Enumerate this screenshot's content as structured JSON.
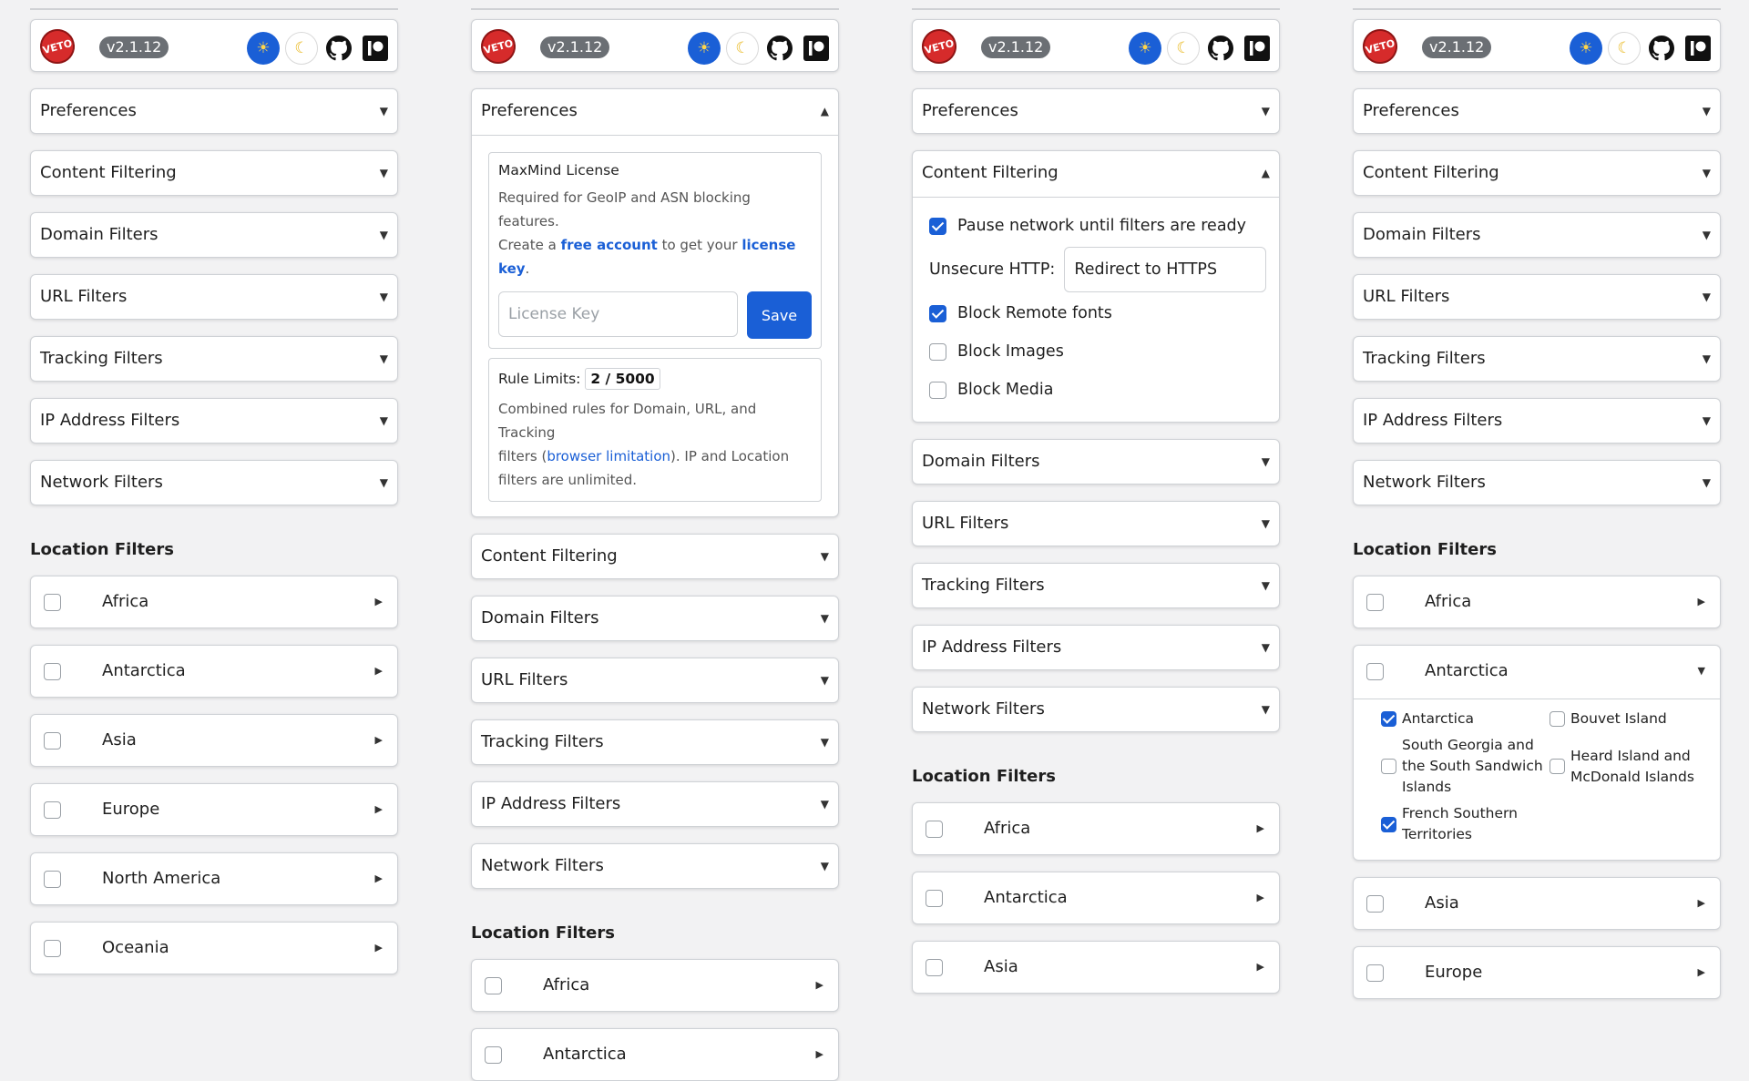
{
  "header": {
    "logo_text": "VETO",
    "version": "v2.1.12",
    "icons": [
      "sun-icon",
      "moon-icon",
      "github-icon",
      "patreon-icon"
    ]
  },
  "accordions": {
    "preferences": "Preferences",
    "content_filtering": "Content Filtering",
    "domain_filters": "Domain Filters",
    "url_filters": "URL Filters",
    "tracking_filters": "Tracking Filters",
    "ip_address_filters": "IP Address Filters",
    "network_filters": "Network Filters"
  },
  "location": {
    "title": "Location Filters",
    "regions": [
      "Africa",
      "Antarctica",
      "Asia",
      "Europe",
      "North America",
      "Oceania"
    ]
  },
  "preferences_panel": {
    "maxmind_title": "MaxMind License",
    "maxmind_text1": "Required for GeoIP and ASN blocking features.",
    "maxmind_text2_pre": "Create a ",
    "maxmind_link1": "free account",
    "maxmind_text2_mid": " to get your ",
    "maxmind_link2": "license key",
    "maxmind_text2_end": ".",
    "license_placeholder": "License Key",
    "save_label": "Save",
    "rule_limits_label": "Rule Limits:",
    "rule_limits_value": "2 / 5000",
    "rule_text1": "Combined rules for Domain, URL, and Tracking",
    "rule_text2_pre": "filters (",
    "rule_link": "browser limitation",
    "rule_text2_post": "). IP and Location",
    "rule_text3": "filters are unlimited."
  },
  "content_filtering_panel": {
    "pause_network": "Pause network until filters are ready",
    "pause_network_checked": true,
    "unsecure_http_label": "Unsecure HTTP:",
    "unsecure_http_value": "Redirect to HTTPS",
    "block_remote_fonts": "Block Remote fonts",
    "block_remote_fonts_checked": true,
    "block_images": "Block Images",
    "block_images_checked": false,
    "block_media": "Block Media",
    "block_media_checked": false
  },
  "antarctica_countries": [
    {
      "name": "Antarctica",
      "checked": true
    },
    {
      "name": "Bouvet Island",
      "checked": false
    },
    {
      "name": "South Georgia and the South Sandwich Islands",
      "checked": false
    },
    {
      "name": "Heard Island and McDonald Islands",
      "checked": false
    },
    {
      "name": "French Southern Territories",
      "checked": true
    }
  ],
  "colors": {
    "accent": "#1a5fd6",
    "logo_red": "#d62b2b",
    "version_badge": "#6b6f74",
    "background": "#f2f2f3"
  }
}
